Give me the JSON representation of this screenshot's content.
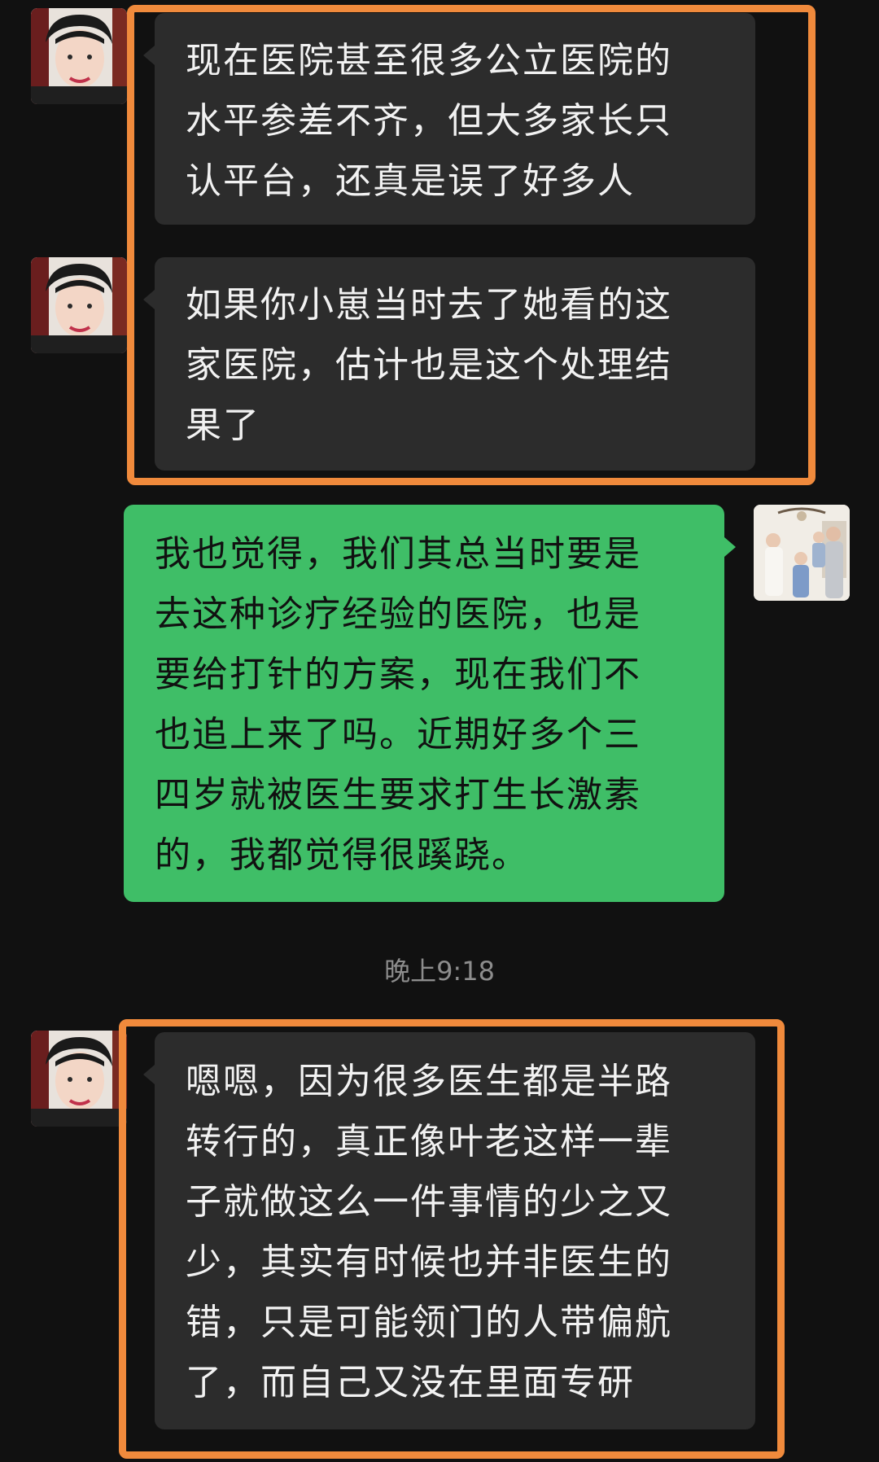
{
  "messages": [
    {
      "sender": "other",
      "lines": [
        "现在医院甚至很多公立医院的",
        "水平参差不齐，但大多家长只",
        "认平台，还真是误了好多人"
      ]
    },
    {
      "sender": "other",
      "lines": [
        "如果你小崽当时去了她看的这",
        "家医院，估计也是这个处理结",
        "果了"
      ]
    },
    {
      "sender": "me",
      "lines": [
        "我也觉得，我们其总当时要是",
        "去这种诊疗经验的医院，也是",
        "要给打针的方案，现在我们不",
        "也追上来了吗。近期好多个三",
        "四岁就被医生要求打生长激素",
        "的，我都觉得很蹊跷。"
      ]
    },
    {
      "sender": "other",
      "lines": [
        "嗯嗯，因为很多医生都是半路",
        "转行的，真正像叶老这样一辈",
        "子就做这么一件事情的少之又",
        "少，其实有时候也并非医生的",
        "错，只是可能领门的人带偏航",
        "了，而自己又没在里面专研"
      ]
    }
  ],
  "timestamp": "晚上9:18",
  "colors": {
    "background": "#111111",
    "bubble_other": "#2c2c2c",
    "bubble_me": "#3fbe67",
    "highlight_border": "#f08a3c",
    "timestamp_text": "#8d8d8d"
  }
}
